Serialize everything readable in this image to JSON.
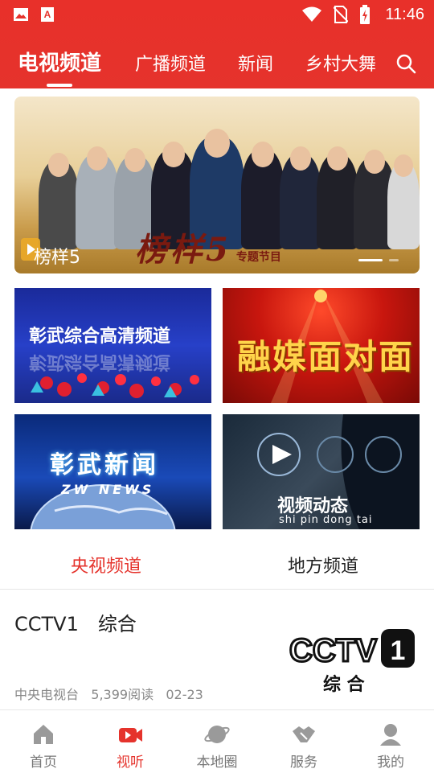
{
  "status_bar": {
    "time": "11:46"
  },
  "top_tabs": [
    {
      "label": "电视频道",
      "active": true
    },
    {
      "label": "广播频道",
      "active": false
    },
    {
      "label": "新闻",
      "active": false
    },
    {
      "label": "乡村大舞",
      "active": false
    }
  ],
  "banner": {
    "title": "榜样5",
    "deco_text": "榜样5",
    "deco_sub": "专题节目"
  },
  "channels": [
    {
      "title": "彰武综合高清频道"
    },
    {
      "title": "融媒面对面"
    },
    {
      "title": "彰武新闻",
      "subtitle": "ZW NEWS"
    },
    {
      "title": "视频动态",
      "subtitle": "shi pin dong tai"
    }
  ],
  "sub_tabs": [
    {
      "label": "央视频道",
      "active": true
    },
    {
      "label": "地方频道",
      "active": false
    }
  ],
  "news_item": {
    "title": "CCTV1　综合",
    "source": "中央电视台",
    "reads": "5,399阅读",
    "date": "02-23",
    "logo_text": "CCTV",
    "logo_number": "1",
    "logo_sub": "综 合"
  },
  "bottom_nav": [
    {
      "label": "首页",
      "icon": "home-icon",
      "active": false
    },
    {
      "label": "视听",
      "icon": "video-icon",
      "active": true
    },
    {
      "label": "本地圈",
      "icon": "planet-icon",
      "active": false
    },
    {
      "label": "服务",
      "icon": "handshake-icon",
      "active": false
    },
    {
      "label": "我的",
      "icon": "user-icon",
      "active": false
    }
  ],
  "colors": {
    "brand_red": "#e5332c",
    "inactive_gray": "#777777"
  }
}
